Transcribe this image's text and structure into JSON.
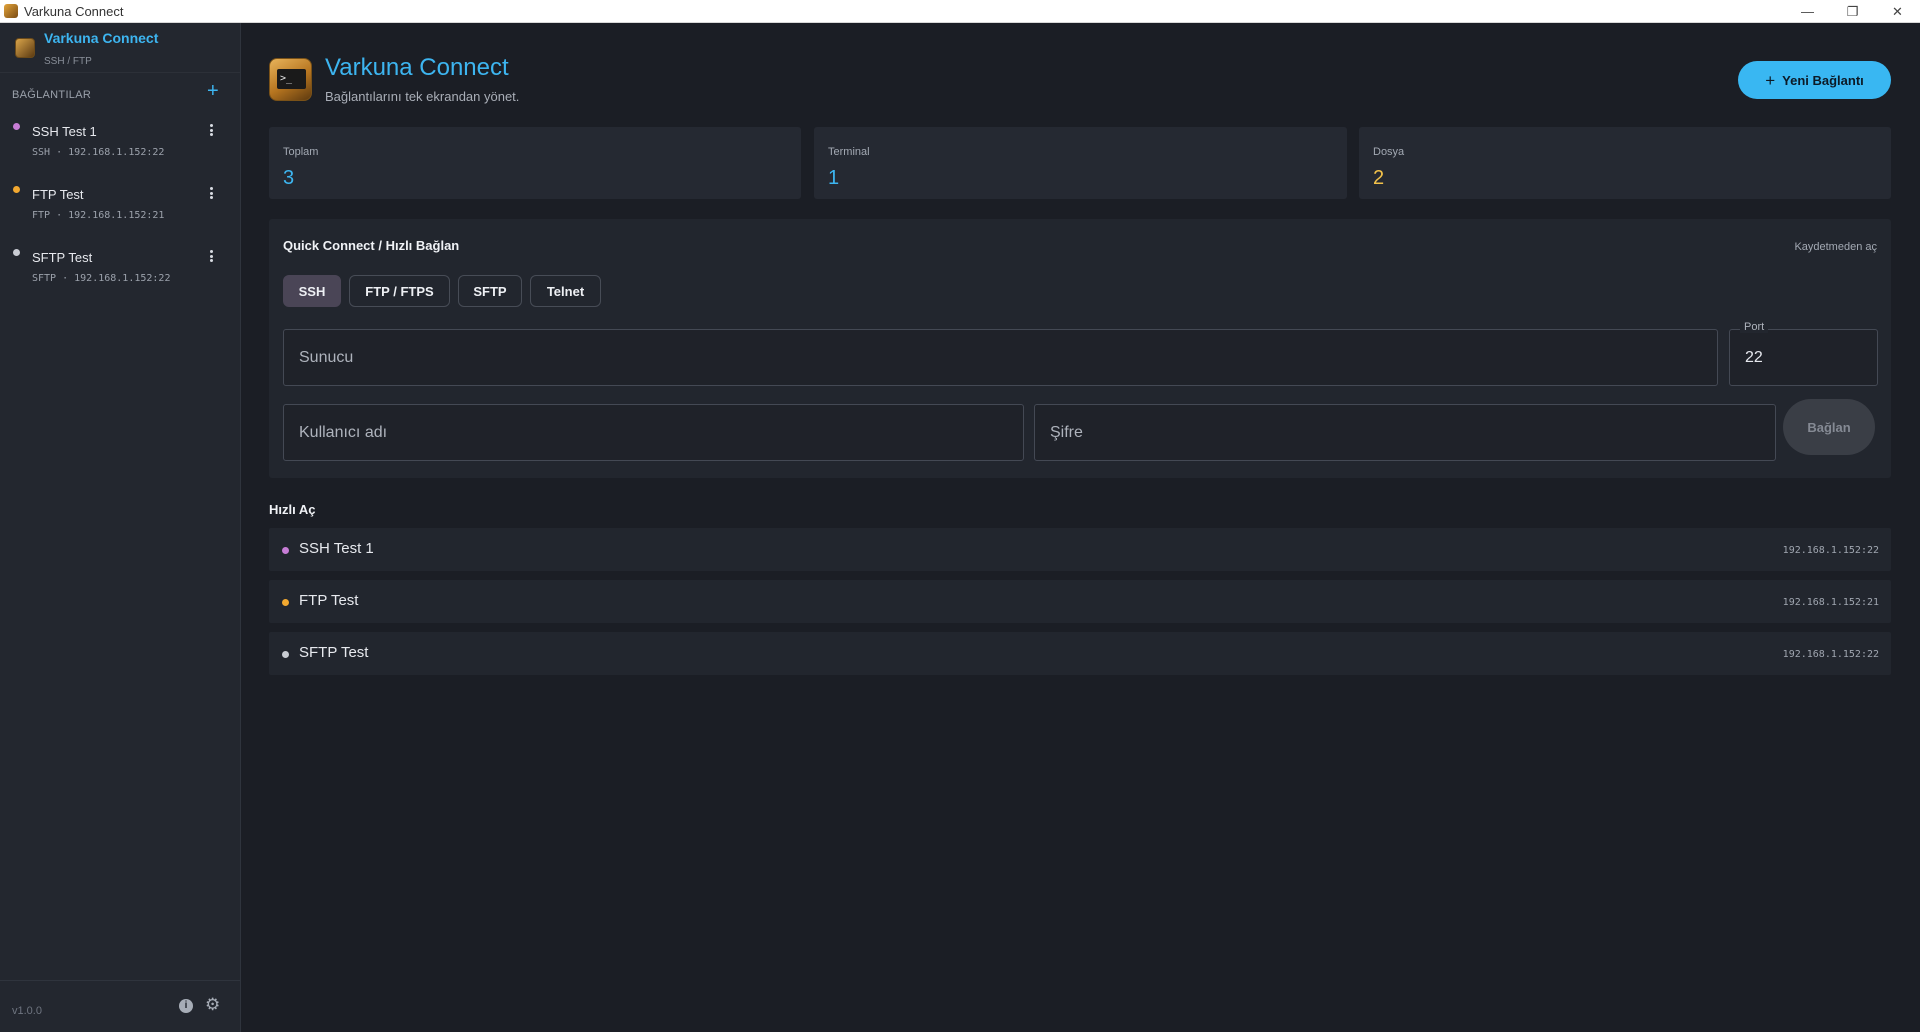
{
  "window": {
    "title": "Varkuna Connect",
    "controls": [
      "—",
      "❐",
      "✕"
    ]
  },
  "sidebar": {
    "brand_name": "Varkuna Connect",
    "brand_sub": "SSH / FTP",
    "section_label": "BAĞLANTILAR",
    "add_icon": "+",
    "items": [
      {
        "name": "SSH Test 1",
        "meta": "SSH · 192.168.1.152:22",
        "dot_color": "#c77dd6"
      },
      {
        "name": "FTP Test",
        "meta": "FTP · 192.168.1.152:21",
        "dot_color": "#f2a830"
      },
      {
        "name": "SFTP Test",
        "meta": "SFTP · 192.168.1.152:22",
        "dot_color": "#c9ccd3"
      }
    ],
    "version": "v1.0.0",
    "info_icon": "i",
    "gear_icon": "⚙"
  },
  "header": {
    "title": "Varkuna Connect",
    "subtitle": "Bağlantılarını tek ekrandan yönet.",
    "logo_glyph": ">_",
    "new_button_icon": "+",
    "new_button_label": "Yeni Bağlantı"
  },
  "stats": [
    {
      "label": "Toplam",
      "value": "3",
      "color": "#3db5f0"
    },
    {
      "label": "Terminal",
      "value": "1",
      "color": "#3db5f0"
    },
    {
      "label": "Dosya",
      "value": "2",
      "color": "#f2c14a"
    }
  ],
  "quick_connect": {
    "title": "Quick Connect / Hızlı Bağlan",
    "no_save_label": "Kaydetmeden aç",
    "protocols": [
      "SSH",
      "FTP / FTPS",
      "SFTP",
      "Telnet"
    ],
    "active_protocol": "SSH",
    "host_placeholder": "Sunucu",
    "port_label": "Port",
    "port_value": "22",
    "username_placeholder": "Kullanıcı adı",
    "password_placeholder": "Şifre",
    "connect_label": "Bağlan"
  },
  "quick_open": {
    "title": "Hızlı Aç",
    "items": [
      {
        "name": "SSH Test 1",
        "address": "192.168.1.152:22",
        "dot_color": "#c77dd6"
      },
      {
        "name": "FTP Test",
        "address": "192.168.1.152:21",
        "dot_color": "#f2a830"
      },
      {
        "name": "SFTP Test",
        "address": "192.168.1.152:22",
        "dot_color": "#c9ccd3"
      }
    ]
  }
}
